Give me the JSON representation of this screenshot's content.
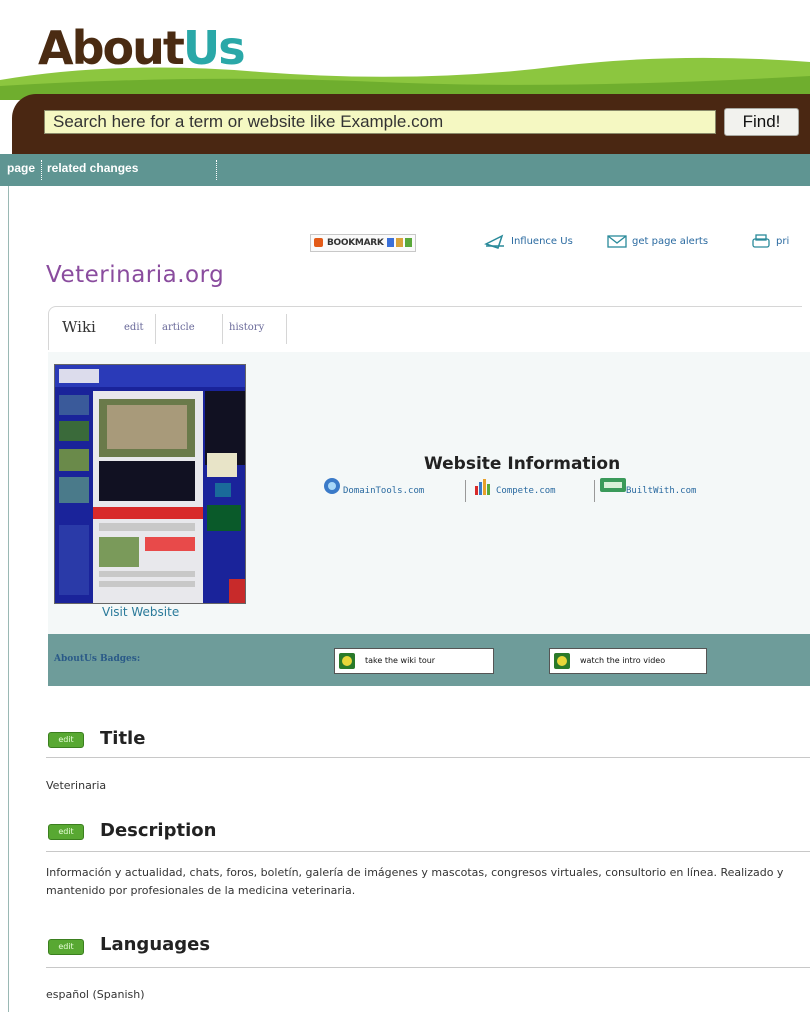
{
  "logo": {
    "part1": "About",
    "part2": "Us"
  },
  "search": {
    "placeholder": "Search here for a term or website like Example.com",
    "button": "Find!"
  },
  "nav": {
    "items": [
      "page",
      "related changes"
    ]
  },
  "toolbar": {
    "bookmark": "BOOKMARK",
    "influence": "Influence Us",
    "alerts": "get page alerts",
    "print": "pri"
  },
  "page": {
    "title": "Veterinaria.org"
  },
  "tabs": {
    "wiki": "Wiki",
    "links": [
      "edit",
      "article",
      "history"
    ]
  },
  "info": {
    "visit": "Visit Website",
    "heading": "Website Information",
    "links": [
      "DomainTools.com",
      "Compete.com",
      "BuiltWith.com"
    ]
  },
  "badges": {
    "label": "AboutUs Badges:",
    "tour": "take the wiki tour",
    "video": "watch the intro video"
  },
  "sections": [
    {
      "edit": "edit",
      "title": "Title",
      "text": "Veterinaria"
    },
    {
      "edit": "edit",
      "title": "Description",
      "text": "Información y actualidad, chats, foros, boletín, galería de imágenes y mascotas, congresos virtuales, consultorio en línea. Realizado y mantenido por profesionales de la medicina veterinaria."
    },
    {
      "edit": "edit",
      "title": "Languages",
      "text": "español (Spanish)"
    }
  ],
  "colors": {
    "brown": "#4a2712",
    "teal": "#5f9592",
    "title_purple": "#8a4c9e",
    "edit_green": "#58a832"
  }
}
